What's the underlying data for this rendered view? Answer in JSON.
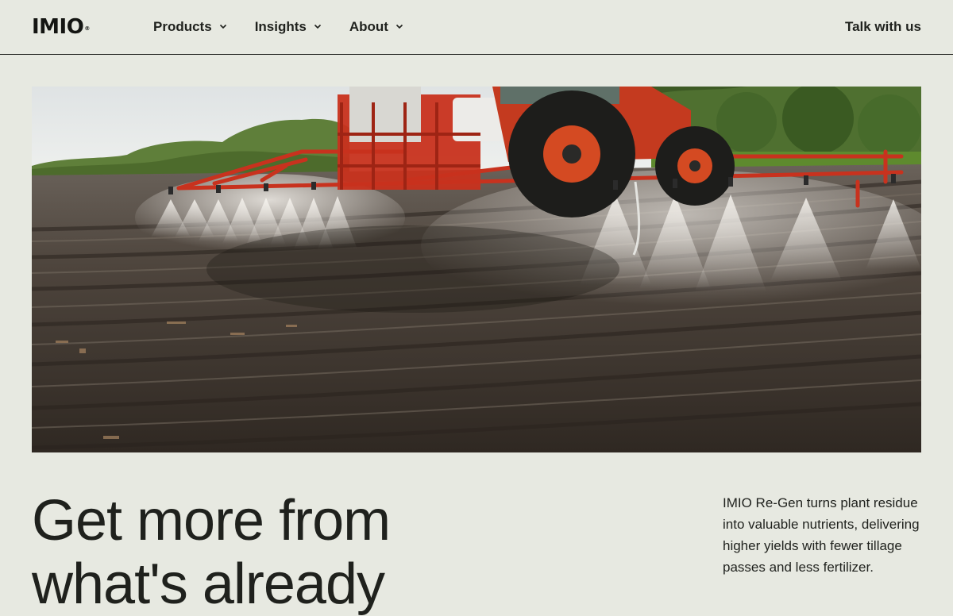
{
  "header": {
    "logo_text": "IMIO",
    "logo_mark": "®",
    "nav": [
      {
        "label": "Products",
        "icon": "chevron-down-icon"
      },
      {
        "label": "Insights",
        "icon": "chevron-down-icon"
      },
      {
        "label": "About",
        "icon": "chevron-down-icon"
      }
    ],
    "cta_label": "Talk with us"
  },
  "hero": {
    "image": "red tractor spraying a plowed field"
  },
  "main": {
    "headline": "Get more from what's already",
    "description": "IMIO Re-Gen turns plant residue into valuable nutrients, delivering higher yields with fewer tillage passes and less fertilizer."
  },
  "colors": {
    "background": "#e7e9e1",
    "text": "#1f211d",
    "tractor_red": "#c8321e"
  }
}
